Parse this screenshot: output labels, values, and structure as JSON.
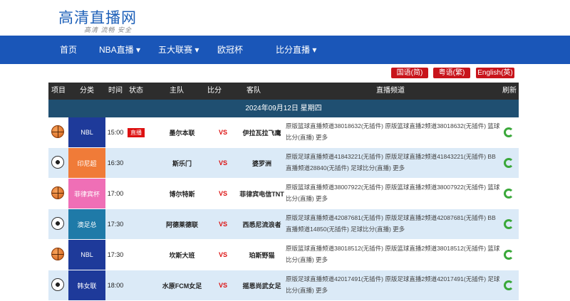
{
  "site": {
    "logo": "高清直播网",
    "slogan": "高清  流畅  安全"
  },
  "nav": [
    "首页",
    "NBA直播 ▾",
    "五大联赛 ▾",
    "欧冠杯",
    "比分直播 ▾"
  ],
  "lang": [
    "国语(简)",
    "粤语(繁)",
    "English(英)"
  ],
  "headers": [
    "项目",
    "分类",
    "时间",
    "状态",
    "主队",
    "比分",
    "客队",
    "直播频道",
    "刷新"
  ],
  "date": "2024年09月12日  星期四",
  "rows": [
    {
      "sport": "basketball",
      "cat": "NBL",
      "catColor": "#1e3a9a",
      "time": "15:00",
      "status": "直播",
      "home": "墨尔本联",
      "score": "VS",
      "away": "伊拉瓦拉飞鹰",
      "channels": "原版篮球直播频道38018632(无插件)  原版篮球直播2频道38018632(无插件)  篮球比分(直播)  更多"
    },
    {
      "sport": "football",
      "cat": "印尼超",
      "catColor": "#f07b38",
      "time": "16:30",
      "status": "",
      "home": "斯乐门",
      "score": "VS",
      "away": "婆罗洲",
      "channels": "原版足球直播频道41843221(无插件)  原版足球直播2频道41843221(无插件)  BB直播频道28840(无插件)  足球比分(直播)  更多"
    },
    {
      "sport": "basketball",
      "cat": "菲律宾杯",
      "catColor": "#ef6fb6",
      "time": "17:00",
      "status": "",
      "home": "博尔特斯",
      "score": "VS",
      "away": "菲律宾电信TNT",
      "channels": "原版篮球直播频道38007922(无插件)  原版篮球直播2频道38007922(无插件)  篮球比分(直播)  更多"
    },
    {
      "sport": "football",
      "cat": "澳足总",
      "catColor": "#1f7aa8",
      "time": "17:30",
      "status": "",
      "home": "阿德莱德联",
      "score": "VS",
      "away": "西悉尼流浪者",
      "channels": "原版足球直播频道42087681(无插件)  原版足球直播2频道42087681(无插件)  BB直播频道14850(无插件)  足球比分(直播)  更多"
    },
    {
      "sport": "basketball",
      "cat": "NBL",
      "catColor": "#1e3a9a",
      "time": "17:30",
      "status": "",
      "home": "坎斯大班",
      "score": "VS",
      "away": "珀斯野猫",
      "channels": "原版篮球直播频道38018512(无插件)  原版篮球直播2频道38018512(无插件)  篮球比分(直播)  更多"
    },
    {
      "sport": "football",
      "cat": "韩女联",
      "catColor": "#1e3a9a",
      "time": "18:00",
      "status": "",
      "home": "水原FCM女足",
      "score": "VS",
      "away": "摇恩尚武女足",
      "channels": "原版足球直播频道42017491(无插件)  原版足球直播2频道42017491(无插件)  足球比分(直播)  更多"
    }
  ]
}
